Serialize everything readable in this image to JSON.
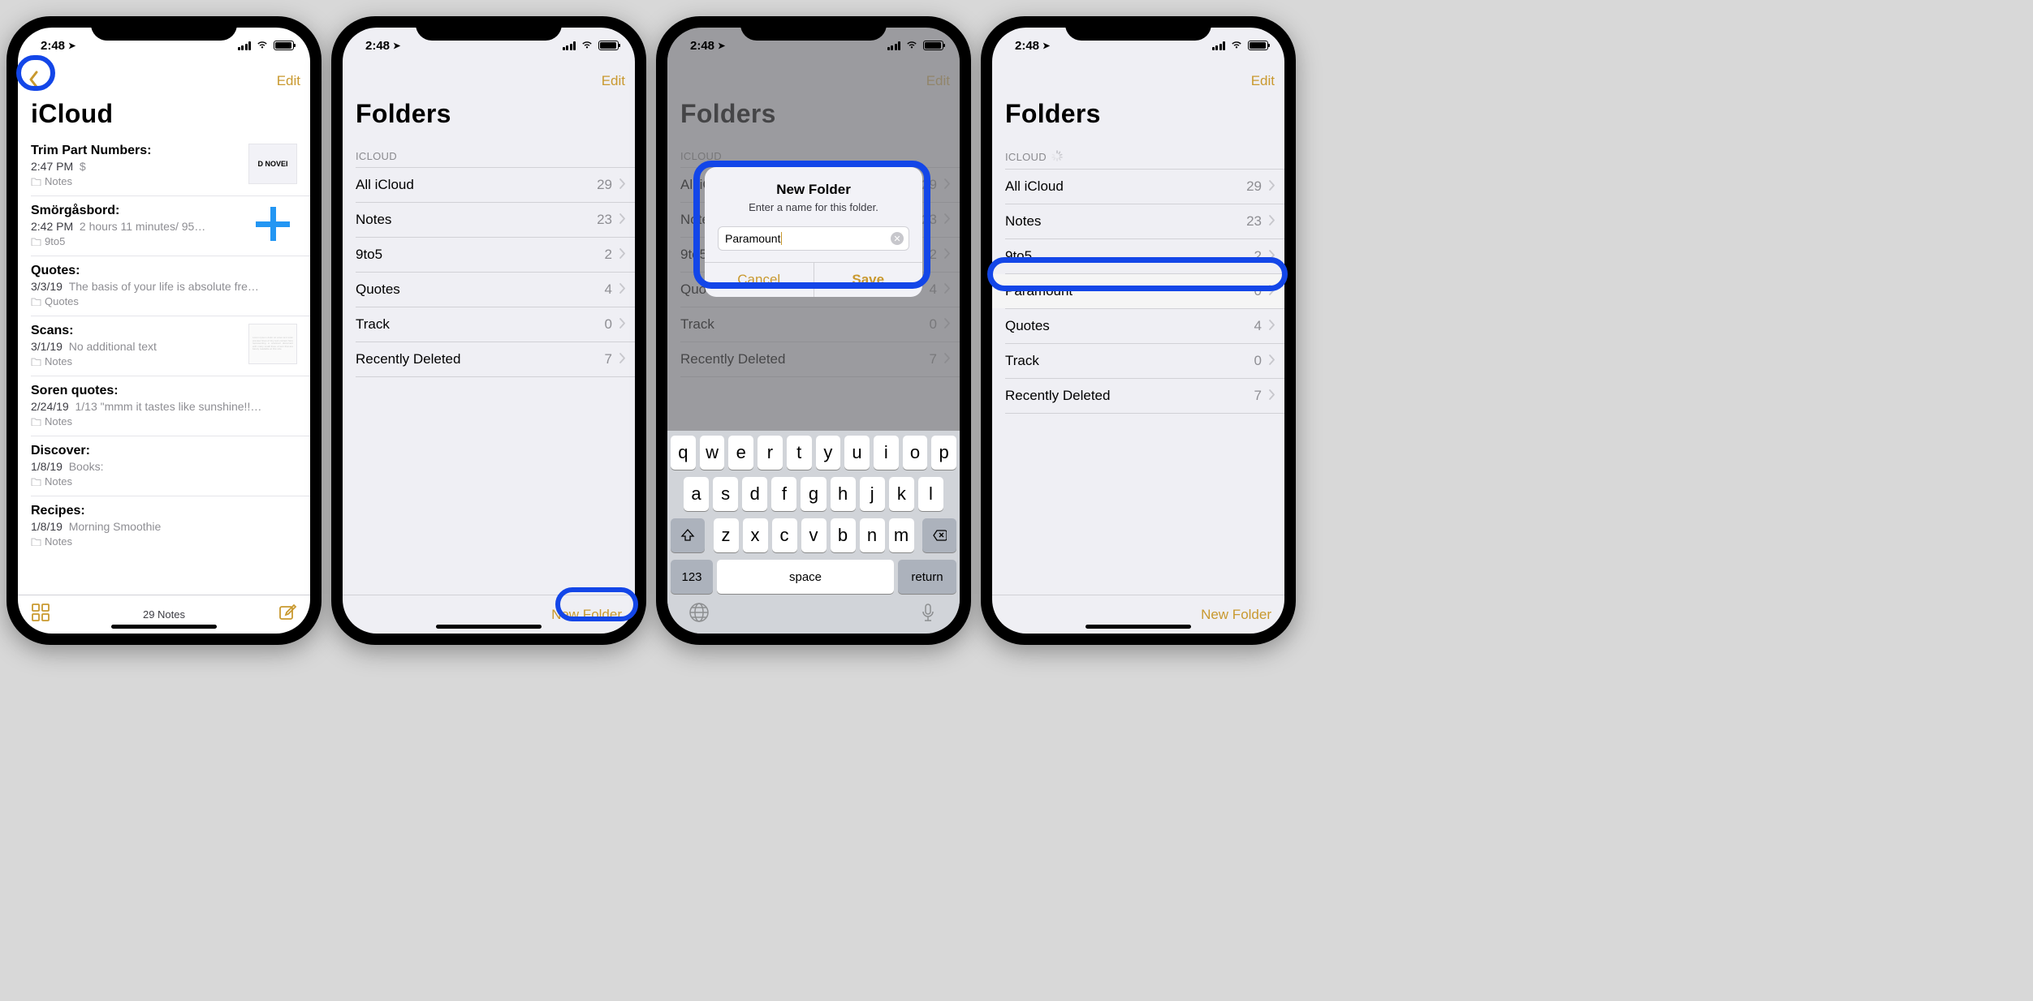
{
  "status": {
    "time": "2:48",
    "loc_glyph": "➤"
  },
  "accent": "#c9992f",
  "annotation_color": "#1346e8",
  "screens": [
    {
      "nav_right": "Edit",
      "title": "iCloud",
      "footer_center": "29 Notes",
      "notes": [
        {
          "title": "Trim Part Numbers:",
          "time": "2:47 PM",
          "preview": "$",
          "folder": "Notes",
          "thumb_text": "D NOVEI"
        },
        {
          "title": "Smörgåsbord:",
          "time": "2:42 PM",
          "preview": "2 hours 11 minutes/ 95…",
          "folder": "9to5",
          "thumb_plus": true
        },
        {
          "title": "Quotes:",
          "time": "3/3/19",
          "preview": "The basis of your life is absolute fre…",
          "folder": "Quotes"
        },
        {
          "title": "Scans:",
          "time": "3/1/19",
          "preview": "No additional text",
          "folder": "Notes",
          "thumb_doc": true
        },
        {
          "title": "Soren quotes:",
          "time": "2/24/19",
          "preview": "1/13 \"mmm it tastes like sunshine!!…",
          "folder": "Notes"
        },
        {
          "title": "Discover:",
          "time": "1/8/19",
          "preview": "Books:",
          "folder": "Notes"
        },
        {
          "title": "Recipes:",
          "time": "1/8/19",
          "preview": "Morning Smoothie",
          "folder": "Notes"
        }
      ]
    },
    {
      "nav_right": "Edit",
      "title": "Folders",
      "section": "ICLOUD",
      "footer_right": "New Folder",
      "folders": [
        {
          "name": "All iCloud",
          "count": "29"
        },
        {
          "name": "Notes",
          "count": "23"
        },
        {
          "name": "9to5",
          "count": "2"
        },
        {
          "name": "Quotes",
          "count": "4"
        },
        {
          "name": "Track",
          "count": "0"
        },
        {
          "name": "Recently Deleted",
          "count": "7"
        }
      ]
    },
    {
      "nav_right": "Edit",
      "title": "Folders",
      "section": "ICLOUD",
      "alert": {
        "title": "New Folder",
        "message": "Enter a name for this folder.",
        "input": "Paramount",
        "cancel": "Cancel",
        "save": "Save"
      },
      "keyboard": {
        "row1": [
          "q",
          "w",
          "e",
          "r",
          "t",
          "y",
          "u",
          "i",
          "o",
          "p"
        ],
        "row2": [
          "a",
          "s",
          "d",
          "f",
          "g",
          "h",
          "j",
          "k",
          "l"
        ],
        "row3": [
          "z",
          "x",
          "c",
          "v",
          "b",
          "n",
          "m"
        ],
        "num": "123",
        "space": "space",
        "return": "return"
      },
      "folders_dim": [
        {
          "name": "All iCloud",
          "count": "29"
        },
        {
          "name": "Notes",
          "count": "23"
        },
        {
          "name": "9to5",
          "count": "2"
        },
        {
          "name": "Quotes",
          "count": "4"
        },
        {
          "name": "Track",
          "count": "0"
        },
        {
          "name": "Recently Deleted",
          "count": "7"
        }
      ]
    },
    {
      "nav_right": "Edit",
      "title": "Folders",
      "section": "ICLOUD",
      "syncing": true,
      "footer_right": "New Folder",
      "folders": [
        {
          "name": "All iCloud",
          "count": "29"
        },
        {
          "name": "Notes",
          "count": "23"
        },
        {
          "name": "9to5",
          "count": "2"
        },
        {
          "name": "Paramount",
          "count": "0",
          "highlight": true
        },
        {
          "name": "Quotes",
          "count": "4"
        },
        {
          "name": "Track",
          "count": "0"
        },
        {
          "name": "Recently Deleted",
          "count": "7"
        }
      ]
    }
  ]
}
